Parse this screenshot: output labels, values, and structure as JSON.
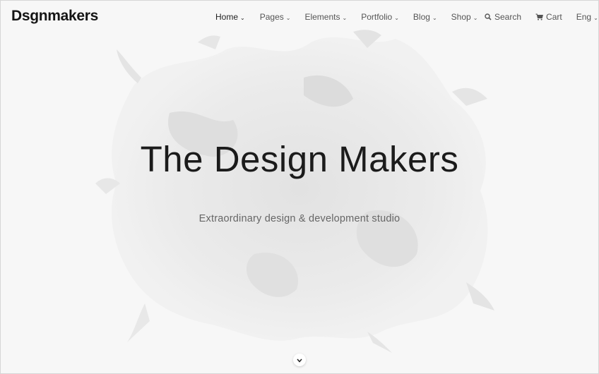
{
  "brand": {
    "name": "Dsgnmakers"
  },
  "nav": {
    "items": [
      {
        "label": "Home",
        "icon": "chevron-down-icon"
      },
      {
        "label": "Pages",
        "icon": "chevron-down-icon"
      },
      {
        "label": "Elements",
        "icon": "chevron-down-icon"
      },
      {
        "label": "Portfolio",
        "icon": "chevron-down-icon"
      },
      {
        "label": "Blog",
        "icon": "chevron-down-icon"
      },
      {
        "label": "Shop",
        "icon": "chevron-down-icon"
      }
    ],
    "active": "Home"
  },
  "utility": {
    "search": {
      "label": "Search",
      "icon": "search-icon"
    },
    "cart": {
      "label": "Cart",
      "icon": "cart-icon"
    },
    "language": {
      "label": "Eng",
      "icon": "chevron-down-icon"
    }
  },
  "hero": {
    "title": "The Design Makers",
    "subtitle": "Extraordinary design & development studio",
    "background": "ink-splash"
  },
  "scroll": {
    "icon": "chevron-down-icon"
  },
  "colors": {
    "text": "#1e1e1e",
    "muted": "#666666",
    "background": "#f7f7f7",
    "splash": "#e6e6e6"
  }
}
